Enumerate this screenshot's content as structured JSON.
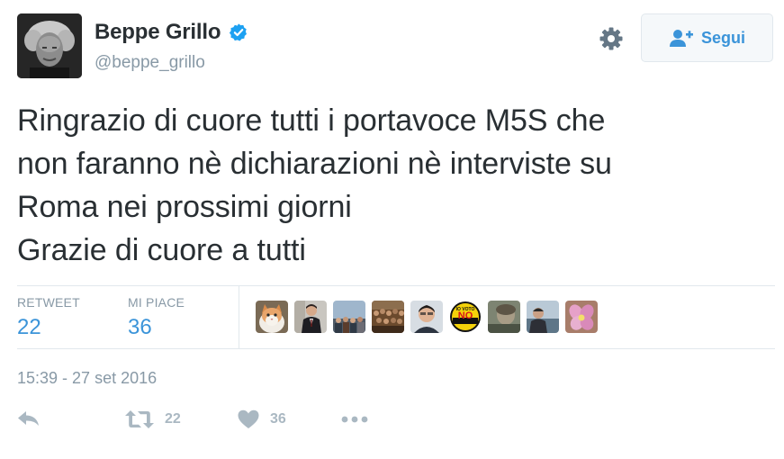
{
  "user": {
    "name": "Beppe Grillo",
    "handle": "@beppe_grillo",
    "verified": true,
    "avatar_icon": "profile-photo"
  },
  "header": {
    "settings_icon": "gear-icon",
    "follow_label": "Segui",
    "follow_icon": "add-user-icon"
  },
  "tweet": {
    "lines": [
      "Ringrazio di cuore tutti i portavoce M5S che",
      "non faranno nè dichiarazioni nè interviste su",
      "Roma nei prossimi giorni",
      "Grazie di cuore a tutti"
    ]
  },
  "stats": {
    "retweet_label": "RETWEET",
    "retweet_count": "22",
    "likes_label": "MI PIACE",
    "likes_count": "36",
    "likers": [
      {
        "icon": "cat-photo"
      },
      {
        "icon": "man-speaking-photo"
      },
      {
        "icon": "crowd-photo"
      },
      {
        "icon": "rally-crowd-photo"
      },
      {
        "icon": "man-portrait-photo"
      },
      {
        "icon": "io-voto-no-badge",
        "badge_top": "IO VOTO",
        "badge_main": "NO"
      },
      {
        "icon": "blurred-portrait-photo"
      },
      {
        "icon": "seaside-man-photo"
      },
      {
        "icon": "pink-flower-photo"
      }
    ]
  },
  "timestamp": "15:39 - 27 set 2016",
  "actions": {
    "reply_icon": "reply-icon",
    "retweet_icon": "retweet-icon",
    "retweet_count": "22",
    "like_icon": "heart-icon",
    "like_count": "36",
    "more_icon": "more-dots-icon"
  },
  "colors": {
    "text": "#292f33",
    "secondary_text": "#8899a6",
    "link_blue": "#3b94d9",
    "icon_gray": "#aab8c2",
    "verified_blue": "#1da1f2",
    "border": "#e1e8ed"
  }
}
